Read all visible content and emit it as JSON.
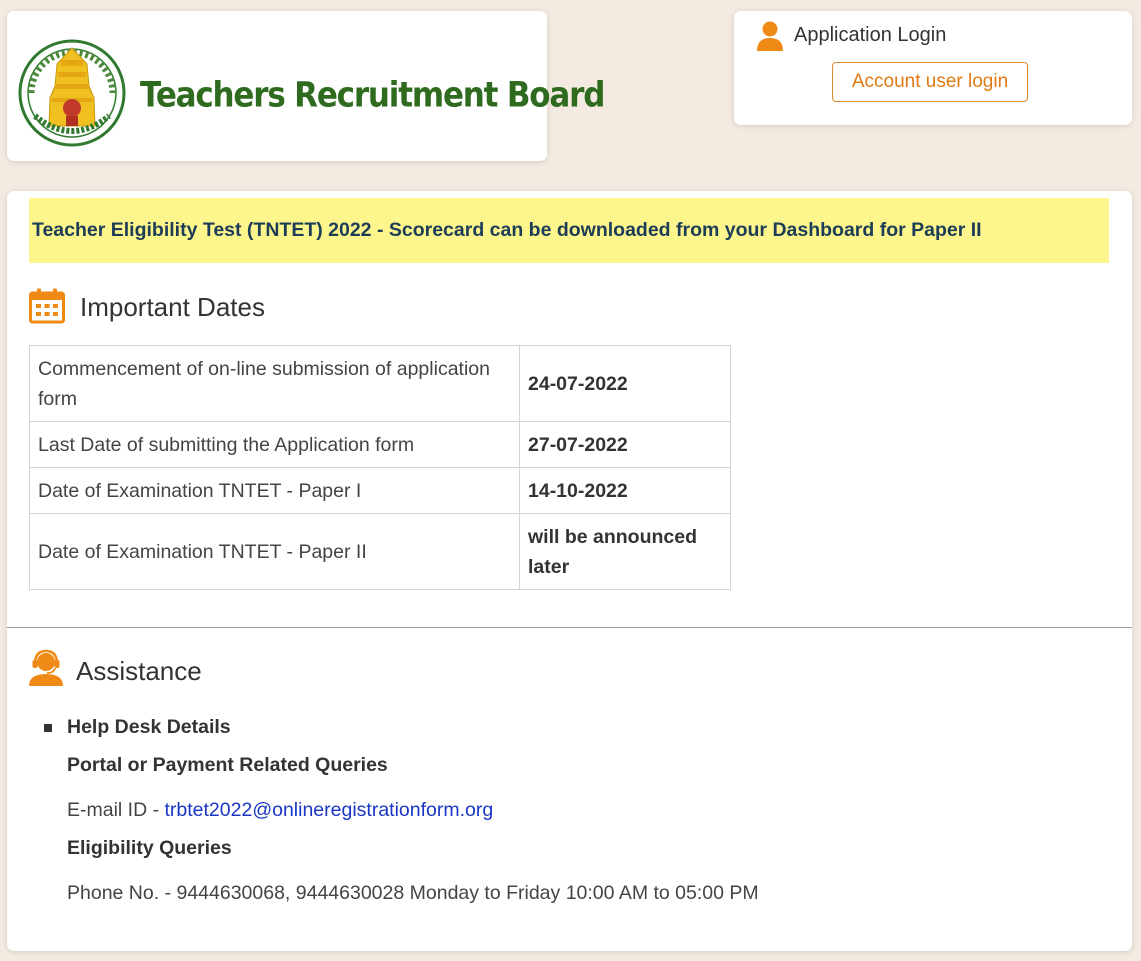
{
  "header": {
    "brand_title": "Teachers Recruitment Board"
  },
  "login": {
    "label": "Application Login",
    "button_label": "Account user login"
  },
  "notice": {
    "text": "Teacher Eligibility Test (TNTET) 2022 - Scorecard can be downloaded from your Dashboard for Paper II"
  },
  "important_dates": {
    "heading": "Important Dates",
    "rows": [
      {
        "event": "Commencement of on-line submission of application form",
        "date": "24-07-2022"
      },
      {
        "event": "Last Date of submitting the Application form",
        "date": "27-07-2022"
      },
      {
        "event": "Date of Examination TNTET - Paper I",
        "date": "14-10-2022"
      },
      {
        "event": "Date of Examination TNTET - Paper II",
        "date": "will be announced later"
      }
    ]
  },
  "assistance": {
    "heading": "Assistance",
    "helpdesk_title": "Help Desk Details",
    "portal_title": "Portal or Payment Related Queries",
    "email_prefix": "E-mail ID - ",
    "email": "trbtet2022@onlineregistrationform.org",
    "eligibility_title": "Eligibility Queries",
    "phone_text": "Phone No. - 9444630068, 9444630028 Monday to Friday 10:00 AM to 05:00 PM"
  },
  "colors": {
    "background": "#f3ebe1",
    "brand_green": "#2e6b1f",
    "accent_orange": "#e07b14",
    "notice_yellow": "#fdf68c",
    "notice_text": "#1d3d57",
    "link_blue": "#1a36c4"
  },
  "icons": {
    "emblem": "tamil-nadu-emblem-icon",
    "login": "user-icon",
    "dates": "calendar-icon",
    "assistance": "headset-icon"
  }
}
